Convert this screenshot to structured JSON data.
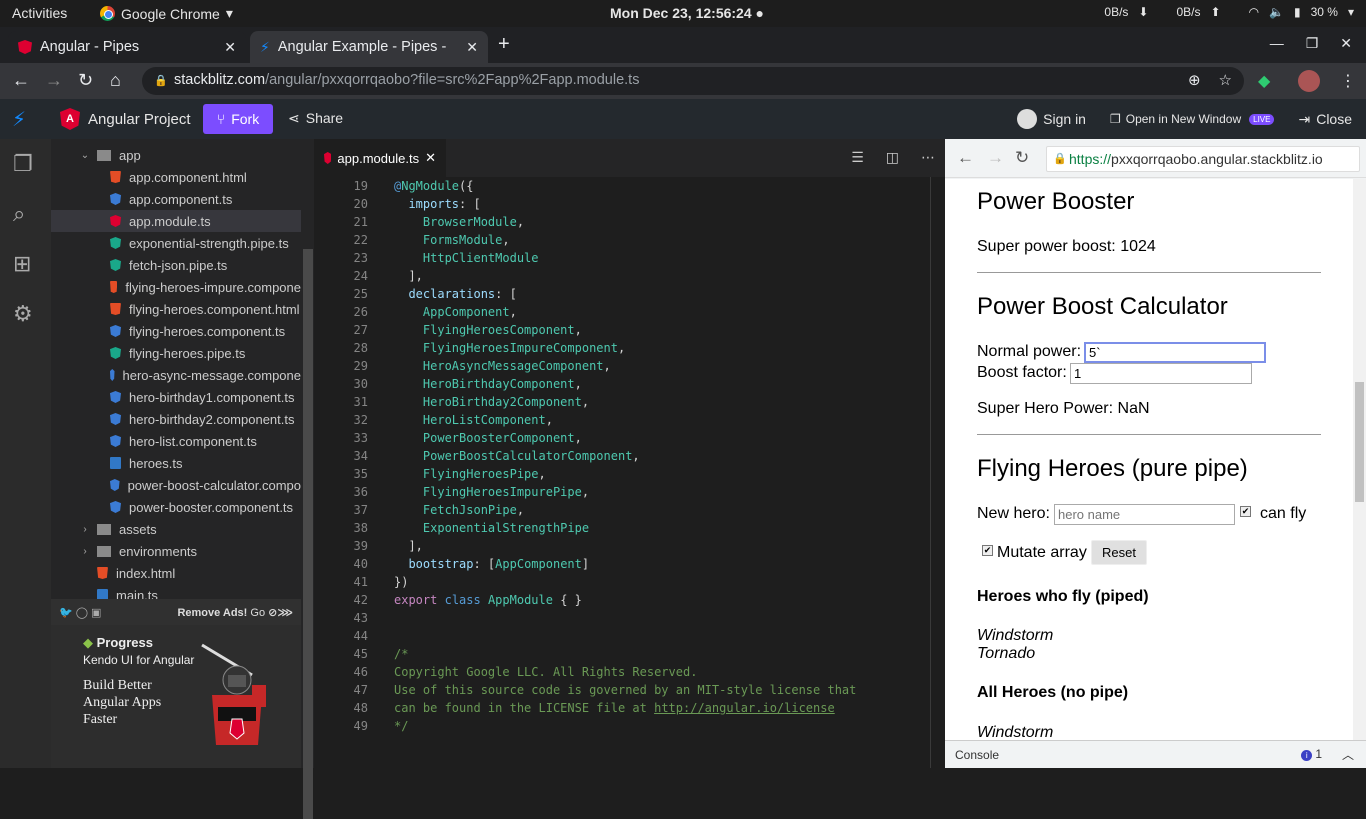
{
  "gnome": {
    "activities": "Activities",
    "app_name": "Google Chrome",
    "clock": "Mon Dec 23, 12:56:24",
    "net_down": "0B/s",
    "net_up": "0B/s",
    "battery": "30 %"
  },
  "browser": {
    "tabs": [
      {
        "title": "Angular - Pipes"
      },
      {
        "title": "Angular Example - Pipes -"
      }
    ],
    "url_host": "stackblitz.com",
    "url_path": "/angular/pxxqorrqaobo?file=src%2Fapp%2Fapp.module.ts"
  },
  "stackblitz": {
    "project_name": "Angular Project",
    "fork_label": "Fork",
    "share_label": "Share",
    "sign_in_label": "Sign in",
    "open_new_window_label": "Open in New Window",
    "live_badge": "LIVE",
    "close_label": "Close"
  },
  "filetree": {
    "items": [
      {
        "label": "app",
        "type": "folder-open"
      },
      {
        "label": "app.component.html",
        "type": "html"
      },
      {
        "label": "app.component.ts",
        "type": "ng-blue"
      },
      {
        "label": "app.module.ts",
        "type": "ng-red",
        "selected": true
      },
      {
        "label": "exponential-strength.pipe.ts",
        "type": "ng-green"
      },
      {
        "label": "fetch-json.pipe.ts",
        "type": "ng-green"
      },
      {
        "label": "flying-heroes-impure.compone",
        "type": "html"
      },
      {
        "label": "flying-heroes.component.html",
        "type": "html"
      },
      {
        "label": "flying-heroes.component.ts",
        "type": "ng-blue"
      },
      {
        "label": "flying-heroes.pipe.ts",
        "type": "ng-green"
      },
      {
        "label": "hero-async-message.compone",
        "type": "ng-blue"
      },
      {
        "label": "hero-birthday1.component.ts",
        "type": "ng-blue"
      },
      {
        "label": "hero-birthday2.component.ts",
        "type": "ng-blue"
      },
      {
        "label": "hero-list.component.ts",
        "type": "ng-blue"
      },
      {
        "label": "heroes.ts",
        "type": "ts"
      },
      {
        "label": "power-boost-calculator.compo",
        "type": "ng-blue"
      },
      {
        "label": "power-booster.component.ts",
        "type": "ng-blue"
      },
      {
        "label": "assets",
        "type": "folder"
      },
      {
        "label": "environments",
        "type": "folder"
      },
      {
        "label": "index.html",
        "type": "html"
      },
      {
        "label": "main.ts",
        "type": "ts"
      }
    ]
  },
  "ad": {
    "remove_ads": "Remove Ads!",
    "go": "Go",
    "brand": "Progress",
    "sub": "Kendo UI for Angular",
    "headline1": "Build Better",
    "headline2": "Angular Apps",
    "headline3": "Faster"
  },
  "editor": {
    "tab": "app.module.ts"
  },
  "preview": {
    "url_scheme": "https://",
    "url_host": "pxxqorrqaobo.angular.stackblitz.io",
    "h_power_booster": "Power Booster",
    "super_power_boost": "Super power boost: 1024",
    "h_calculator": "Power Boost Calculator",
    "normal_power_label": "Normal power:",
    "normal_power_value": "5`",
    "boost_factor_label": "Boost factor:",
    "boost_factor_value": "1",
    "super_hero_power": "Super Hero Power: NaN",
    "h_flying": "Flying Heroes (pure pipe)",
    "new_hero_label": "New hero:",
    "new_hero_placeholder": "hero name",
    "can_fly_label": "can fly",
    "mutate_label": "Mutate array",
    "reset_label": "Reset",
    "h_piped": "Heroes who fly (piped)",
    "piped_heroes": [
      "Windstorm",
      "Tornado"
    ],
    "h_nopipe": "All Heroes (no pipe)",
    "nopipe_heroes": [
      "Windstorm"
    ],
    "console_label": "Console",
    "console_count": "1"
  }
}
